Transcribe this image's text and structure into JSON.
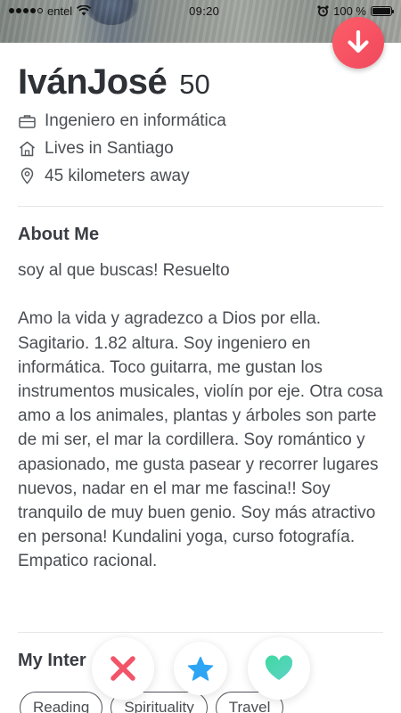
{
  "status_bar": {
    "carrier": "entel",
    "time": "09:20",
    "battery_percent": "100 %",
    "battery_level": 1.0,
    "signal_bars": 4
  },
  "header": {
    "action_icon": "arrow-down-icon",
    "action_color": "#f4505f"
  },
  "profile": {
    "name": "IvánJosé",
    "age": "50",
    "facts": [
      {
        "icon": "briefcase-icon",
        "text": "Ingeniero en informática"
      },
      {
        "icon": "home-icon",
        "text": "Lives in Santiago"
      },
      {
        "icon": "location-pin-icon",
        "text": "45 kilometers away"
      }
    ]
  },
  "about": {
    "title": "About Me",
    "body": "soy al que buscas! Resuelto\n\nAmo la vida y agradezco a Dios por ella. Sagitario. 1.82 altura. Soy ingeniero en informática. Toco guitarra, me gustan los instrumentos musicales, violín por eje. Otra cosa amo a los animales, plantas y árboles son parte de mi ser, el mar la cordillera. Soy romántico y apasionado, me gusta pasear y recorrer lugares nuevos, nadar en el mar me fascina!! Soy tranquilo de muy buen genio. Soy más atractivo en persona! Kundalini yoga, curso fotografía. Empatico racional."
  },
  "interests": {
    "title": "My Inter",
    "items": [
      "Reading",
      "Spirituality",
      "Travel"
    ]
  },
  "actions": {
    "nope": {
      "icon": "close-icon",
      "color": "#f25468"
    },
    "super_like": {
      "icon": "star-icon",
      "color": "#2ea5f4"
    },
    "like": {
      "icon": "heart-icon",
      "color": "#4fd8b0"
    }
  }
}
